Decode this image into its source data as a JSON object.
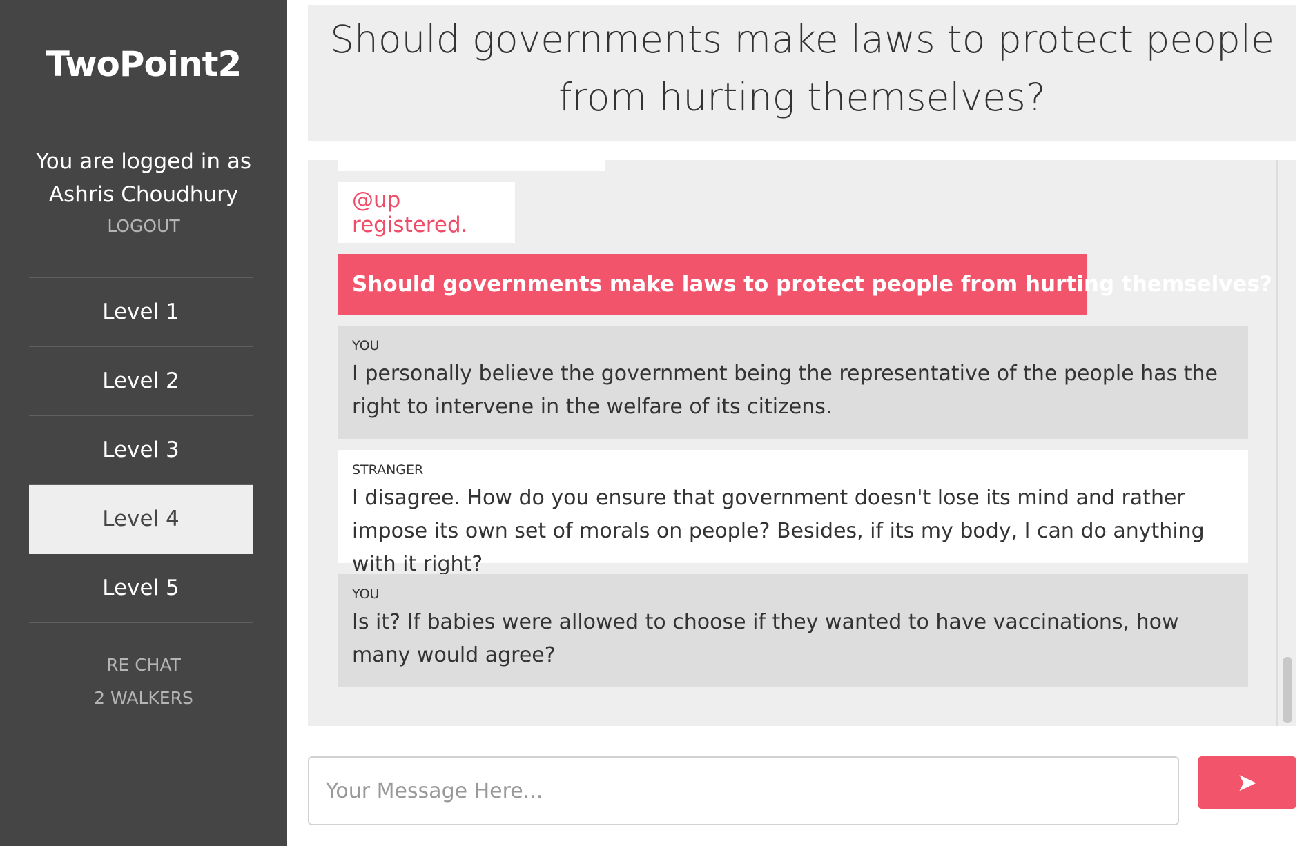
{
  "app": {
    "name": "TwoPoint2"
  },
  "sidebar": {
    "login_line1": "You are logged in as",
    "login_line2": "Ashris Choudhury",
    "logout_label": "LOGOUT",
    "levels": [
      {
        "label": "Level 1"
      },
      {
        "label": "Level 2"
      },
      {
        "label": "Level 3"
      },
      {
        "label": "Level 4",
        "active": true
      },
      {
        "label": "Level 5"
      }
    ],
    "extras": {
      "rechat_label": "RE CHAT",
      "walkers_label": "2 WALKERS"
    }
  },
  "header": {
    "title": "Should governments make laws to protect people from hurting themselves?"
  },
  "chat": {
    "notice": "@up registered.",
    "question": "Should governments make laws to protect people from hurting themselves?",
    "messages": [
      {
        "sender": "YOU",
        "text": "I personally believe the government being the representative of the people has the right to intervene in the welfare of its citizens."
      },
      {
        "sender": "STRANGER",
        "text": "I disagree. How do you ensure that government doesn't lose its mind and rather impose its own set of morals on people? Besides, if its my body, I can do anything with it right?"
      },
      {
        "sender": "YOU",
        "text": "Is it? If babies were allowed to choose if they wanted to have vaccinations, how many would agree?"
      }
    ]
  },
  "composer": {
    "placeholder": "Your Message Here...",
    "send_icon": "➤"
  },
  "colors": {
    "sidebar_bg": "#454545",
    "accent": "#f2546b",
    "panel_bg": "#eeeeee",
    "you_bubble": "#dddddd"
  }
}
